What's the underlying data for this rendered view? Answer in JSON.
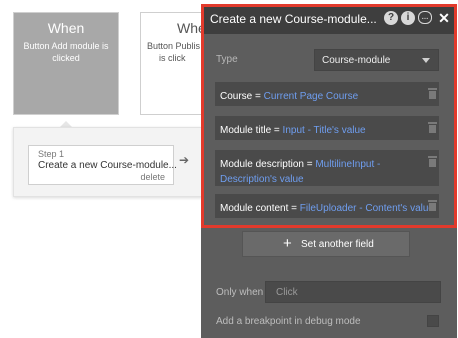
{
  "events": {
    "active": {
      "title": "When",
      "description": "Button Add module is clicked"
    },
    "other": {
      "title": "Whe",
      "description_line1": "Button Publis",
      "description_line2": "is click"
    }
  },
  "action": {
    "step_label": "Step 1",
    "step_text": "Create a new Course-module...",
    "delete_label": "delete"
  },
  "panel": {
    "title": "Create a new Course-module...",
    "header_icons": [
      "help-icon",
      "info-icon",
      "comment-icon",
      "close-icon"
    ],
    "help_glyph": "?",
    "info_glyph": "i",
    "close_glyph": "✕",
    "type_label": "Type",
    "type_value": "Course-module",
    "fields": [
      {
        "key": "Course",
        "eq": "=",
        "value": "Current Page Course"
      },
      {
        "key": "Module title",
        "eq": "=",
        "value": "Input - Title's value"
      },
      {
        "key": "Module description",
        "eq": "=",
        "value": "MultilineInput - Description's value"
      },
      {
        "key": "Module content",
        "eq": "=",
        "value": "FileUploader - Content's value"
      }
    ],
    "set_field_plus": "+",
    "set_field_label": "Set another field",
    "only_when_label": "Only when",
    "only_when_placeholder": "Click",
    "breakpoint_label": "Add a breakpoint in debug mode"
  },
  "colors": {
    "highlight": "#e23a2c",
    "panel_bg": "#5d5d5d",
    "dynamic_value": "#6f9ef0"
  }
}
